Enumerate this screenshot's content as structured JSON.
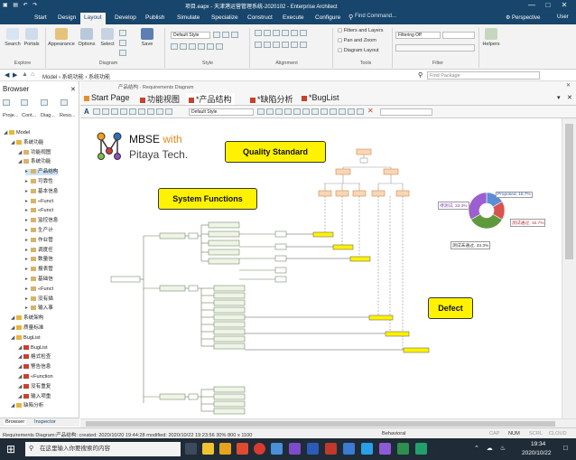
{
  "window": {
    "title": "项目.eapx - 天津港运营管理系统-2020102 - Enterprise Architect",
    "quick_access": "▣ ▤ ↶ ↷"
  },
  "ribbon_tabs": [
    "Start",
    "Design",
    "Layout",
    "Develop",
    "Publish",
    "Simulate",
    "Specialize",
    "Construct",
    "Execute",
    "Configure"
  ],
  "find_command": "Find Command...",
  "perspective": "Perspective",
  "user": "User",
  "ribbon": {
    "buttons": [
      {
        "label": "Search"
      },
      {
        "label": "Portals"
      },
      {
        "label": "Appearance"
      },
      {
        "label": "Options"
      },
      {
        "label": "Select"
      },
      {
        "label": "Save"
      }
    ],
    "groups": [
      "Explore",
      "Diagram",
      "Style",
      "Alignment",
      "Tools",
      "Filter"
    ],
    "default_style": "Default Style",
    "tools": [
      "Filters and Layers",
      "Pan and Zoom",
      "Diagram Layout"
    ],
    "filtering": "Filtering Off",
    "helpers": "Helpers"
  },
  "address": {
    "breadcrumb": "Model  › 系统功能  › 系统功能",
    "find_package": "Find Package"
  },
  "browser": {
    "title": "Browser",
    "tabs": [
      "Proje...",
      "Cont...",
      "Diag...",
      "Reso..."
    ],
    "tree": [
      {
        "label": "Model",
        "indent": 0
      },
      {
        "label": "系统功能",
        "indent": 1
      },
      {
        "label": "功能视图",
        "indent": 2
      },
      {
        "label": "系统功能",
        "indent": 2
      },
      {
        "label": "产品结构",
        "indent": 3
      },
      {
        "label": "可靠性",
        "indent": 3
      },
      {
        "label": "基本信息",
        "indent": 3
      },
      {
        "label": "«Funct",
        "indent": 3
      },
      {
        "label": "«Funct",
        "indent": 3
      },
      {
        "label": "监控信息",
        "indent": 3
      },
      {
        "label": "生产计",
        "indent": 3
      },
      {
        "label": "作业管",
        "indent": 3
      },
      {
        "label": "调度任",
        "indent": 3
      },
      {
        "label": "数量信",
        "indent": 3
      },
      {
        "label": "报表管",
        "indent": 3
      },
      {
        "label": "基础信",
        "indent": 3
      },
      {
        "label": "«Funct",
        "indent": 3
      },
      {
        "label": "没有描",
        "indent": 3
      },
      {
        "label": "输入事",
        "indent": 3
      },
      {
        "label": "系统架构",
        "indent": 1
      },
      {
        "label": "质量标准",
        "indent": 1
      },
      {
        "label": "BugList",
        "indent": 1
      },
      {
        "label": "BugList",
        "indent": 2
      },
      {
        "label": "格式检查",
        "indent": 2
      },
      {
        "label": "警告信息",
        "indent": 2
      },
      {
        "label": "«Function",
        "indent": 2
      },
      {
        "label": "没有重复",
        "indent": 2
      },
      {
        "label": "输入项重",
        "indent": 2
      },
      {
        "label": "缺陷分析",
        "indent": 1
      }
    ],
    "bottom_tabs": [
      "Browser",
      "Inspector"
    ]
  },
  "diagram_path": "产品结构 · Requirements Diagram",
  "doc_tabs": [
    "Start Page",
    "功能视图",
    "*产品结构",
    "*缺陷分析",
    "*BugList"
  ],
  "diagram_style": "Default Style",
  "logo": {
    "mbse": "MBSE",
    "with": "with",
    "company": "Pitaya Tech."
  },
  "callouts": {
    "quality": "Quality Standard",
    "functions": "System Functions",
    "defect": "Defect"
  },
  "pie_labels": [
    "Proposed, 16.7%",
    "测试通过, 16.7%",
    "测试未通过, 33.3%",
    "待测试, 33.3%"
  ],
  "chart_data": {
    "type": "pie",
    "categories": [
      "Proposed",
      "测试通过",
      "测试未通过",
      "待测试"
    ],
    "values": [
      16.7,
      16.7,
      33.3,
      33.3
    ],
    "colors": [
      "#5b8ed6",
      "#d9534f",
      "#5e9a3c",
      "#9b5fd0"
    ]
  },
  "statusbar": {
    "left": "Requirements Diagram:产品结构:  created: 2020/10/20 19:44:28  modified: 2020/10/22 19:23:56  30%  800 x 1100",
    "mode": "Behavioral",
    "keys": [
      "CAP",
      "NUM",
      "SCRL",
      "CLOUD"
    ]
  },
  "taskbar": {
    "search": "在这里输入你要搜索的内容",
    "time": "19:34",
    "date": "2020/10/22"
  }
}
